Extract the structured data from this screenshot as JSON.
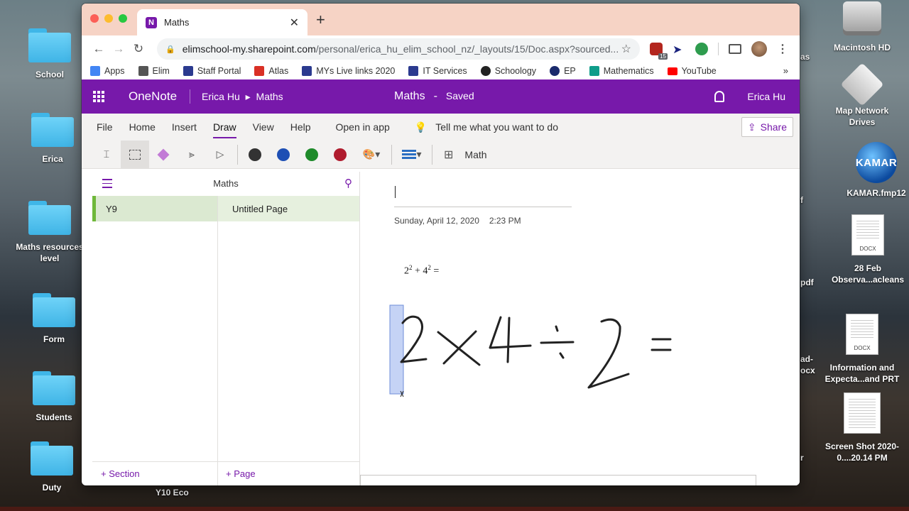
{
  "desktop": {
    "left_items": [
      {
        "label": "School"
      },
      {
        "label": "Erica"
      },
      {
        "label": "Maths resources level"
      },
      {
        "label": "Form"
      },
      {
        "label": "Students"
      },
      {
        "label": "Duty"
      }
    ],
    "right_items": [
      {
        "label": "Macintosh HD"
      },
      {
        "label": "Map Network Drives"
      },
      {
        "label": "KAMAR.fmp12",
        "icon_text": "KAMAR"
      },
      {
        "label": "28 Feb Observa...acleans",
        "thumb_text": "DOCX"
      },
      {
        "label": "Information and Expecta...and PRT",
        "thumb_text": "DOCX"
      },
      {
        "label": "Screen Shot 2020-0....20.14 PM"
      }
    ],
    "partial_labels": [
      "as",
      "f",
      "pdf",
      "ad-",
      "ocx",
      "r"
    ],
    "behind_label": "Y10 Eco"
  },
  "browser": {
    "tab_title": "Maths",
    "url_host": "elimschool-my.sharepoint.com",
    "url_path": "/personal/erica_hu_elim_school_nz/_layouts/15/Doc.aspx?sourced...",
    "extension_badge": "15",
    "bookmarks": [
      {
        "label": "Apps",
        "color": "#4285f4"
      },
      {
        "label": "Elim",
        "color": "#555555"
      },
      {
        "label": "Staff Portal",
        "color": "#2b3a8f"
      },
      {
        "label": "Atlas",
        "color": "#d93025"
      },
      {
        "label": "MYs Live links 2020",
        "color": "#2b3a8f"
      },
      {
        "label": "IT Services",
        "color": "#2b3a8f"
      },
      {
        "label": "Schoology",
        "color": "#222222"
      },
      {
        "label": "EP",
        "color": "#1a2a6c"
      },
      {
        "label": "Mathematics",
        "color": "#0f9d8a"
      },
      {
        "label": "YouTube",
        "color": "#ff0000"
      }
    ]
  },
  "onenote": {
    "app_name": "OneNote",
    "breadcrumb_user": "Erica Hu",
    "breadcrumb_sep": "▸",
    "breadcrumb_notebook": "Maths",
    "doc_title": "Maths",
    "dash": "-",
    "save_status": "Saved",
    "user_name": "Erica Hu",
    "accent": "#7719aa",
    "ribbon_tabs": [
      "File",
      "Home",
      "Insert",
      "Draw",
      "View",
      "Help",
      "Open in app"
    ],
    "active_tab": "Draw",
    "tell_me": "Tell me what you want to do",
    "share_label": "Share",
    "pen_colors": [
      "#333333",
      "#1e4fb4",
      "#1e8a2a",
      "#b01c2e"
    ],
    "math_label": "Math",
    "notebook_name": "Maths",
    "section": "Y9",
    "page": "Untitled Page",
    "add_section": "Section",
    "add_page": "Page",
    "page_date": "Sunday, April 12, 2020",
    "page_time": "2:23 PM",
    "equation": {
      "a": "2",
      "a_exp": "2",
      "op": "+",
      "b": "4",
      "b_exp": "2",
      "eq": "="
    }
  }
}
